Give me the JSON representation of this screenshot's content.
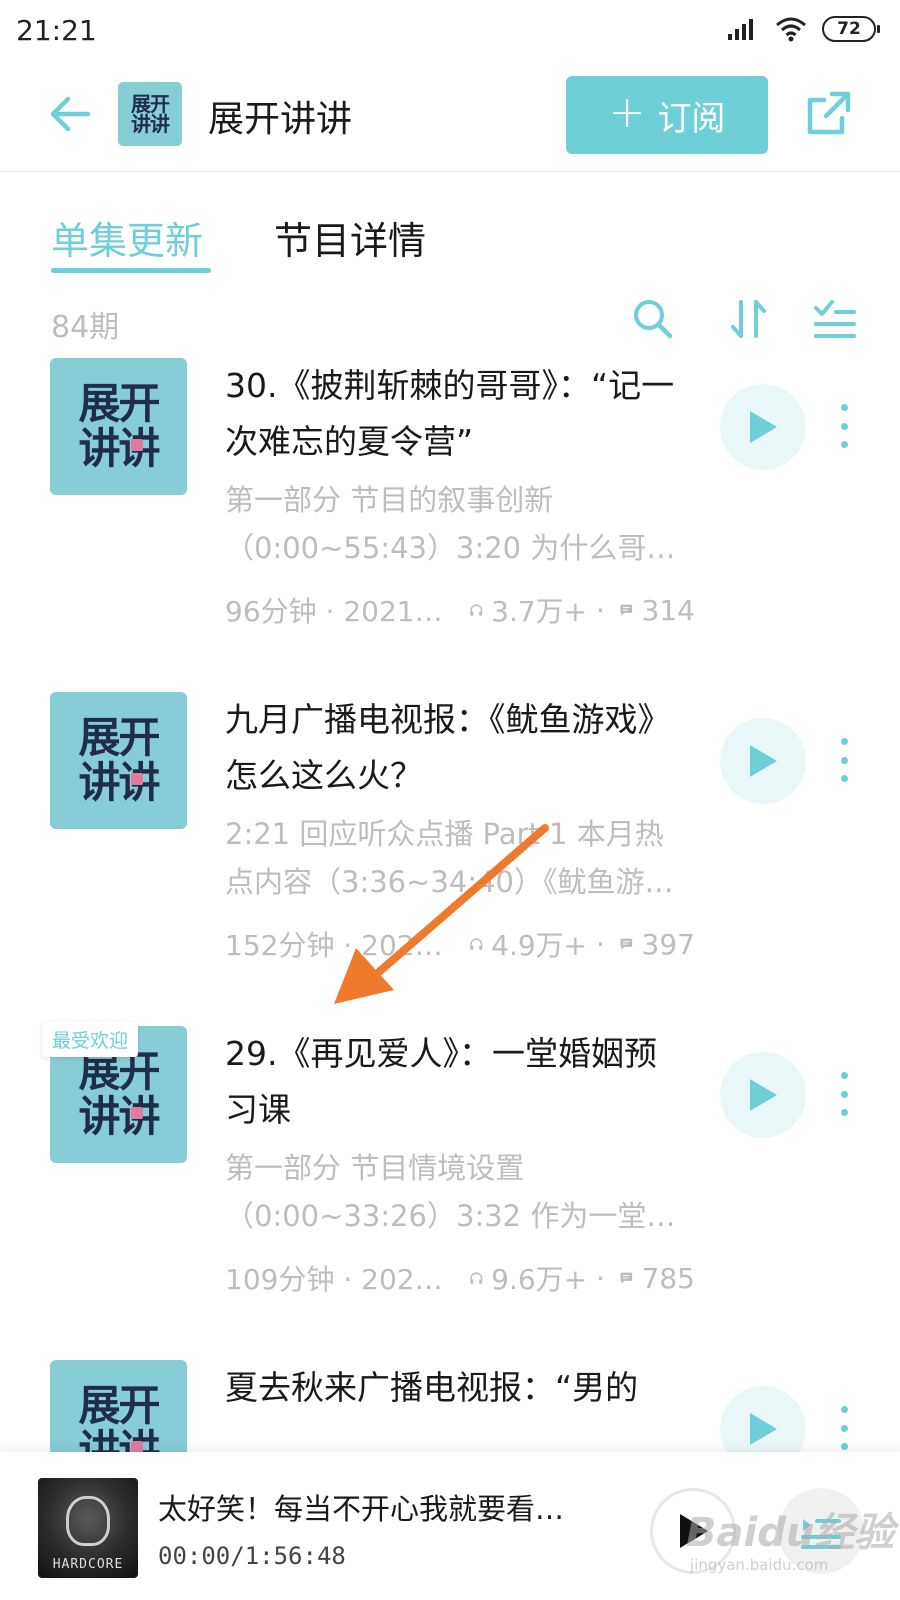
{
  "status_bar": {
    "time": "21:21",
    "battery": "72"
  },
  "header": {
    "logo_text": [
      "展开",
      "讲讲"
    ],
    "title": "展开讲讲",
    "subscribe_label": "订阅"
  },
  "tabs": [
    {
      "label": "单集更新",
      "active": true
    },
    {
      "label": "节目详情",
      "active": false
    }
  ],
  "list_toolbar": {
    "count": "84期"
  },
  "episodes": [
    {
      "title": "30.《披荆斩棘的哥哥》：“记一次难忘的夏令营”",
      "desc_line1": "第一部分 节目的叙事创新",
      "desc_line2": "（0:00~55:43）3:20 为什么哥…",
      "duration_date": "96分钟 · 2021…",
      "plays": "3.7万+",
      "comments": "314"
    },
    {
      "title": "九月广播电视报：《鱿鱼游戏》怎么这么火？",
      "desc_line1": "2:21 回应听众点播 Part 1 本月热",
      "desc_line2": "点内容（3:36~34:40）《鱿鱼游…",
      "duration_date": "152分钟 · 202…",
      "plays": "4.9万+",
      "comments": "397"
    },
    {
      "badge": "最受欢迎",
      "title": "29.《再见爱人》：一堂婚姻预习课",
      "desc_line1": "第一部分 节目情境设置",
      "desc_line2": "（0:00~33:26）3:32 作为一堂…",
      "duration_date": "109分钟 · 202…",
      "plays": "9.6万+",
      "comments": "785"
    },
    {
      "title": "夏去秋来广播电视报：“男的"
    }
  ],
  "player": {
    "title": "太好笑！每当不开心我就要看…",
    "time": "00:00/1:56:48",
    "cover_text": "HARDCORE"
  },
  "watermark": {
    "text": "Baidu经验",
    "sub": "jingyan.baidu.com"
  },
  "colors": {
    "accent": "#6fcfd9",
    "thumb_bg": "#86cdd6",
    "arrow": "#f07a2b",
    "muted_text": "#bdbdbd"
  }
}
